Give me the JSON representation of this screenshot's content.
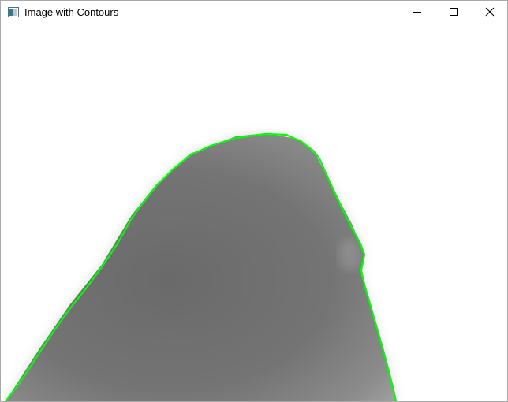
{
  "window": {
    "title": "Image with Contours"
  },
  "titlebar": {
    "app_icon": "window-app-icon",
    "controls": {
      "minimize_icon": "minimize-icon",
      "maximize_icon": "maximize-icon",
      "close_icon": "close-icon"
    }
  },
  "image": {
    "contour_color": "#00ff00",
    "object_color": "#6e6e6e",
    "background_color": "#ffffff"
  }
}
